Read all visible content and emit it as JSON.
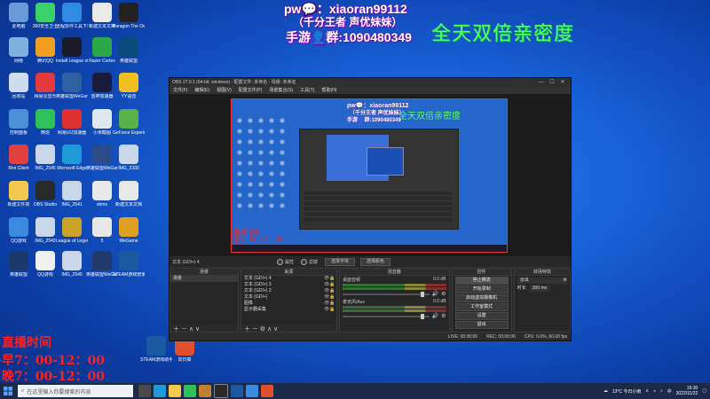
{
  "overlay": {
    "pw_line": "pw💬：xiaoran99112",
    "subtitle": "（千分王者 声优妹妹）",
    "qun_line": "手游👤群:1090480349",
    "banner": "全天双倍亲密度",
    "live_title": "直播时间",
    "morning": "早7：00-12：00",
    "evening": "晚7：00-12：00"
  },
  "desktop_icons": [
    {
      "label": "此电脑",
      "color": "#6a9ad8"
    },
    {
      "label": "360安全卫士",
      "color": "#3ad06a"
    },
    {
      "label": "远程协作工具下载",
      "color": "#2f8be0"
    },
    {
      "label": "新建文本文档",
      "color": "#eaeaea"
    },
    {
      "label": "Paragon The Owl",
      "color": "#222222"
    },
    {
      "label": "网络",
      "color": "#7fb0e0"
    },
    {
      "label": "腾讯QQ",
      "color": "#f0a020"
    },
    {
      "label": "Install League of",
      "color": "#1a1a2a"
    },
    {
      "label": "Razer Cortex",
      "color": "#2aa84a"
    },
    {
      "label": "英雄联盟",
      "color": "#0a4a7a"
    },
    {
      "label": "回收站",
      "color": "#cfdcef"
    },
    {
      "label": "网易云音乐",
      "color": "#e33b3b"
    },
    {
      "label": "英雄联盟WeGame版",
      "color": "#3060a0"
    },
    {
      "label": "雷神加速器",
      "color": "#1a1a3a"
    },
    {
      "label": "YY语音",
      "color": "#f0c020"
    },
    {
      "label": "控制面板",
      "color": "#4a90d8"
    },
    {
      "label": "微信",
      "color": "#2ec15a"
    },
    {
      "label": "网易UU加速器",
      "color": "#e03030"
    },
    {
      "label": "小米截图",
      "color": "#e0e8f0"
    },
    {
      "label": "GeForce Experience",
      "color": "#5ab04a"
    },
    {
      "label": "Riot Client",
      "color": "#e04040"
    },
    {
      "label": "IMG_2545",
      "color": "#c9d6e8"
    },
    {
      "label": "Microsoft Edge",
      "color": "#1f9ad8"
    },
    {
      "label": "英雄联盟WeGame",
      "color": "#2a4a8a"
    },
    {
      "label": "IMG_2330",
      "color": "#c9d6e8"
    },
    {
      "label": "新建文件夹",
      "color": "#f2c94c"
    },
    {
      "label": "OBS Studio",
      "color": "#2a2a2a"
    },
    {
      "label": "IMG_2541",
      "color": "#c9d6e8"
    },
    {
      "label": "shms",
      "color": "#e8e8e8"
    },
    {
      "label": "新建文本文档",
      "color": "#e8e8e8"
    },
    {
      "label": "QQ游戏",
      "color": "#3a8ae0"
    },
    {
      "label": "IMG_2542",
      "color": "#c9d6e8"
    },
    {
      "label": "League of Legends",
      "color": "#c9a227"
    },
    {
      "label": "5",
      "color": "#e8e8e8"
    },
    {
      "label": "WeGame",
      "color": "#e0a020"
    },
    {
      "label": "英雄联盟",
      "color": "#1a3a6a"
    },
    {
      "label": "QQ游戏",
      "color": "#f0f0f0"
    },
    {
      "label": "IMG_2540",
      "color": "#c9d6e8"
    },
    {
      "label": "英雄联盟WeGame版",
      "color": "#203a6a"
    },
    {
      "label": "STEAM游戏管家",
      "color": "#1a5aa0"
    },
    {
      "label": "STEAM游戏助手",
      "color": "#1a5aa0"
    },
    {
      "label": "向日葵",
      "color": "#e05030"
    }
  ],
  "obs": {
    "title": "OBS 27.0.1 (64-bit, windows) - 配置文件: 未命名 - 场景: 未命名",
    "menu": [
      "文件(F)",
      "编辑(E)",
      "视图(V)",
      "配置文件(P)",
      "场景集合(S)",
      "工具(T)",
      "帮助(H)"
    ],
    "source_label": "文本 (GDI+) 4",
    "radio_props": "属性",
    "radio_filters": "滤镜",
    "btn_select": "选择字体",
    "btn_edit": "选择颜色",
    "docks": {
      "scenes": "场景",
      "sources": "来源",
      "mixer": "混音器",
      "controls": "控件",
      "transitions": "转场特效"
    },
    "scene_items": [
      "场景"
    ],
    "source_items": [
      "文本 (GDI+) 4",
      "文本 (GDI+) 3",
      "文本 (GDI+) 2",
      "文本 (GDI+)",
      "图像",
      "显示器采集"
    ],
    "mixer_items": [
      {
        "name": "桌面音频",
        "db": "0.0 dB"
      },
      {
        "name": "麦克风/Aux",
        "db": "0.0 dB"
      }
    ],
    "controls": [
      "停止推流",
      "开始录制",
      "启动虚拟摄像机",
      "工作室模式",
      "设置",
      "退出"
    ],
    "transition_type": "淡出",
    "duration_label": "时长",
    "duration_value": "300 ms",
    "status": {
      "live": "LIVE: 00:00:00",
      "rec": "REC: 00:00:00",
      "cpu": "CPU: 6.0%, 60.00 fps"
    }
  },
  "taskbar": {
    "search_placeholder": "在这里输入你要搜索的内容",
    "weather": "13°C 今日小雨",
    "ime": "中",
    "time": "19:30",
    "date": "2022/11/22"
  }
}
